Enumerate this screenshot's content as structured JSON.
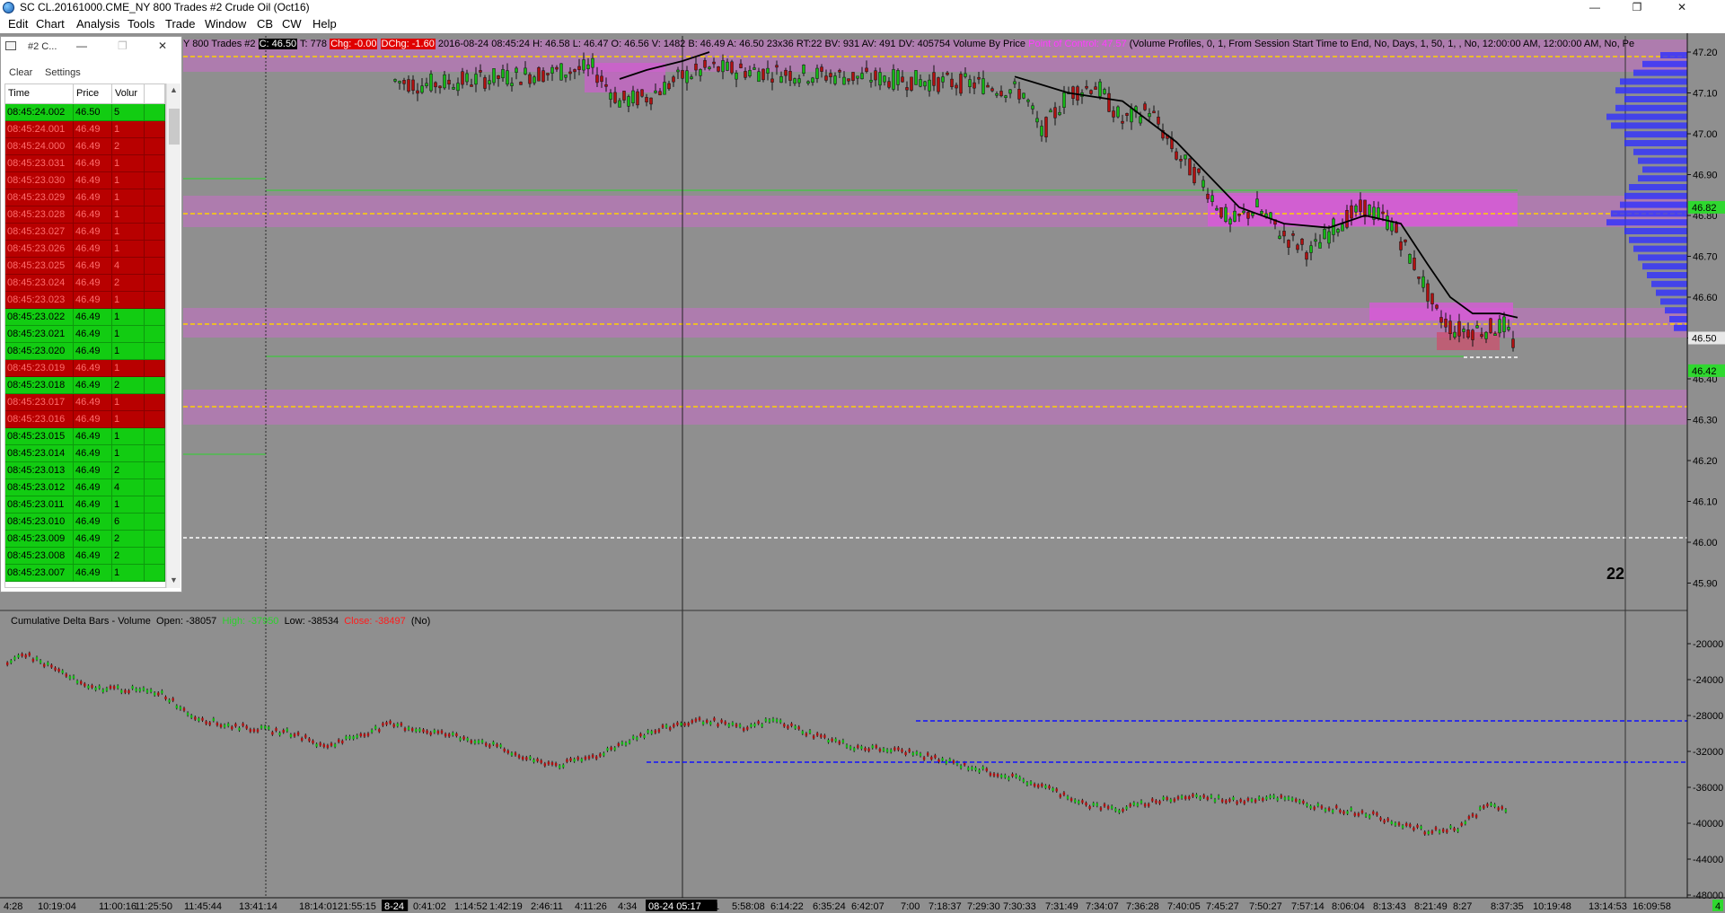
{
  "window": {
    "title": "SC CL.20161000.CME_NY  800 Trades  #2  Crude Oil (Oct16)",
    "min_glyph": "—",
    "max_glyph": "❐",
    "close_glyph": "✕"
  },
  "menu": [
    "Edit",
    "Chart",
    "Analysis",
    "Tools",
    "Trade",
    "Window",
    "CB",
    "CW",
    "Help"
  ],
  "info_bar": {
    "prefix": "Y  800 Trades  #2",
    "close": "C: 46.50",
    "trades": "T: 778",
    "chg": "Chg: -0.00",
    "dchg": "DChg: -1.60",
    "ohlc": "2016-08-24 08:45:24 H: 46.58 L: 46.47 O: 46.56 V: 1482 B: 46.49 A: 46.50 23x36 RT:22 BV: 931 AV: 491 DV: 405754 Volume By Price",
    "poc": "Point of Control: 47.57",
    "profile": "(Volume Profiles, 0, 1, From Session Start Time to End, No, Days, 1, 50, 1, , No, 12:00:00 AM, 12:00:00 AM, No, Pe"
  },
  "price_axis": {
    "labels": [
      "47.20",
      "47.10",
      "47.00",
      "46.90",
      "46.80",
      "46.70",
      "46.60",
      "46.50",
      "46.40",
      "46.30",
      "46.20",
      "46.10",
      "46.00",
      "45.90"
    ],
    "current_price": "46.50",
    "high_marker": "46.82",
    "low_marker": "46.42"
  },
  "delta_axis": {
    "labels": [
      "-20000",
      "-24000",
      "-28000",
      "-32000",
      "-36000",
      "-40000",
      "-44000",
      "-48000"
    ]
  },
  "delta_header": {
    "title": "Cumulative Delta Bars - Volume",
    "open": "Open: -38057",
    "high": "High: -37950",
    "low": "Low: -38534",
    "close": "Close: -38497",
    "flag": "(No)"
  },
  "bar_counter": "22",
  "time_axis": {
    "labels": [
      "4:28",
      "10:19:04",
      "11:00:16",
      "11:25:50",
      "11:45:44",
      "13:41:14",
      "18:14:01",
      "21:55:15",
      "8-24",
      "0:41:02",
      "1:14:52",
      "1:42:19",
      "2:46:11",
      "4:11:26",
      "4:34",
      "08-24  05:17",
      "1",
      "5:58:08",
      "6:14:22",
      "6:35:24",
      "6:42:07",
      "7:00",
      "7:18:37",
      "7:29:30",
      "7:30:33",
      "7:31:49",
      "7:34:07",
      "7:36:28",
      "7:40:05",
      "7:45:27",
      "7:50:27",
      "7:57:14",
      "8:06:04",
      "8:13:43",
      "8:21:49",
      "8:27",
      "8:37:35",
      "10:19:48",
      "13:14:53",
      "16:09:58"
    ],
    "highlighted": [
      "8-24",
      "08-24  05:17"
    ],
    "last_badge": "4"
  },
  "time_and_sales": {
    "title": "#2 C...",
    "menu": [
      "Clear",
      "Settings"
    ],
    "columns": [
      "Time",
      "Price",
      "Volur",
      ""
    ],
    "rows": [
      {
        "time": "08:45:24.002",
        "price": "46.50",
        "vol": "5",
        "side": "buy"
      },
      {
        "time": "08:45:24.001",
        "price": "46.49",
        "vol": "1",
        "side": "sell"
      },
      {
        "time": "08:45:24.000",
        "price": "46.49",
        "vol": "2",
        "side": "sell"
      },
      {
        "time": "08:45:23.031",
        "price": "46.49",
        "vol": "1",
        "side": "sell"
      },
      {
        "time": "08:45:23.030",
        "price": "46.49",
        "vol": "1",
        "side": "sell"
      },
      {
        "time": "08:45:23.029",
        "price": "46.49",
        "vol": "1",
        "side": "sell"
      },
      {
        "time": "08:45:23.028",
        "price": "46.49",
        "vol": "1",
        "side": "sell"
      },
      {
        "time": "08:45:23.027",
        "price": "46.49",
        "vol": "1",
        "side": "sell"
      },
      {
        "time": "08:45:23.026",
        "price": "46.49",
        "vol": "1",
        "side": "sell"
      },
      {
        "time": "08:45:23.025",
        "price": "46.49",
        "vol": "4",
        "side": "sell"
      },
      {
        "time": "08:45:23.024",
        "price": "46.49",
        "vol": "2",
        "side": "sell"
      },
      {
        "time": "08:45:23.023",
        "price": "46.49",
        "vol": "1",
        "side": "sell"
      },
      {
        "time": "08:45:23.022",
        "price": "46.49",
        "vol": "1",
        "side": "buy"
      },
      {
        "time": "08:45:23.021",
        "price": "46.49",
        "vol": "1",
        "side": "buy"
      },
      {
        "time": "08:45:23.020",
        "price": "46.49",
        "vol": "1",
        "side": "buy"
      },
      {
        "time": "08:45:23.019",
        "price": "46.49",
        "vol": "1",
        "side": "sell"
      },
      {
        "time": "08:45:23.018",
        "price": "46.49",
        "vol": "2",
        "side": "buy"
      },
      {
        "time": "08:45:23.017",
        "price": "46.49",
        "vol": "1",
        "side": "sell"
      },
      {
        "time": "08:45:23.016",
        "price": "46.49",
        "vol": "1",
        "side": "sell"
      },
      {
        "time": "08:45:23.015",
        "price": "46.49",
        "vol": "1",
        "side": "buy"
      },
      {
        "time": "08:45:23.014",
        "price": "46.49",
        "vol": "1",
        "side": "buy"
      },
      {
        "time": "08:45:23.013",
        "price": "46.49",
        "vol": "2",
        "side": "buy"
      },
      {
        "time": "08:45:23.012",
        "price": "46.49",
        "vol": "4",
        "side": "buy"
      },
      {
        "time": "08:45:23.011",
        "price": "46.49",
        "vol": "1",
        "side": "buy"
      },
      {
        "time": "08:45:23.010",
        "price": "46.49",
        "vol": "6",
        "side": "buy"
      },
      {
        "time": "08:45:23.009",
        "price": "46.49",
        "vol": "2",
        "side": "buy"
      },
      {
        "time": "08:45:23.008",
        "price": "46.49",
        "vol": "2",
        "side": "buy"
      },
      {
        "time": "08:45:23.007",
        "price": "46.49",
        "vol": "1",
        "side": "buy"
      }
    ]
  },
  "colors": {
    "background": "#8f8f8f",
    "buy": "#12cc12",
    "sell": "#b80000",
    "value_area": "#c86ec8",
    "poc_line": "#ffd200",
    "blue_level": "#1010ff"
  }
}
